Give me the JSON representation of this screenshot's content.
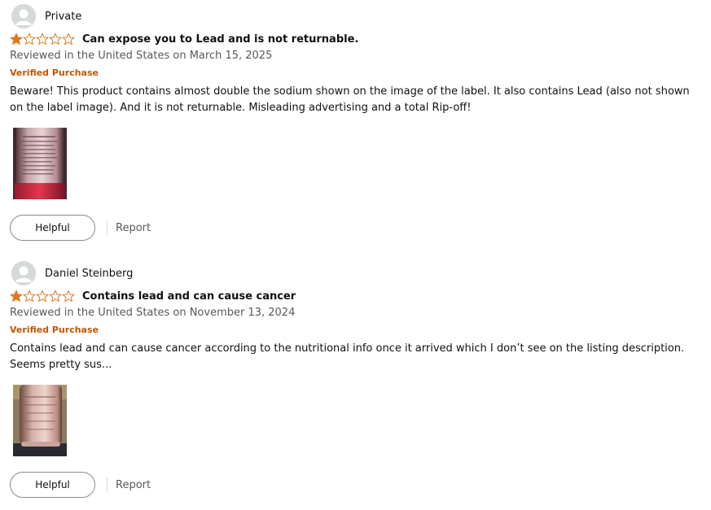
{
  "reviews": [
    {
      "reviewer": "Private",
      "rating": 1,
      "max_rating": 5,
      "title": "Can expose you to Lead and is not returnable.",
      "date": "Reviewed in the United States on March 15, 2025",
      "verified": "Verified Purchase",
      "body": "Beware! This product contains almost double the sodium shown on the image of the label. It also contains Lead (also not shown on the label image). And it is not returnable. Misleading advertising and a total Rip-off!",
      "helpful_label": "Helpful",
      "report_label": "Report"
    },
    {
      "reviewer": "Daniel Steinberg",
      "rating": 1,
      "max_rating": 5,
      "title": "Contains lead and can cause cancer",
      "date": "Reviewed in the United States on November 13, 2024",
      "verified": "Verified Purchase",
      "body": "Contains lead and can cause cancer according to the nutritional info once it arrived which I don’t see on the listing description. Seems pretty sus...",
      "helpful_label": "Helpful",
      "report_label": "Report"
    }
  ],
  "colors": {
    "star": "#de7921",
    "verified": "#c45500",
    "muted_text": "#565959",
    "text": "#0f1111"
  }
}
